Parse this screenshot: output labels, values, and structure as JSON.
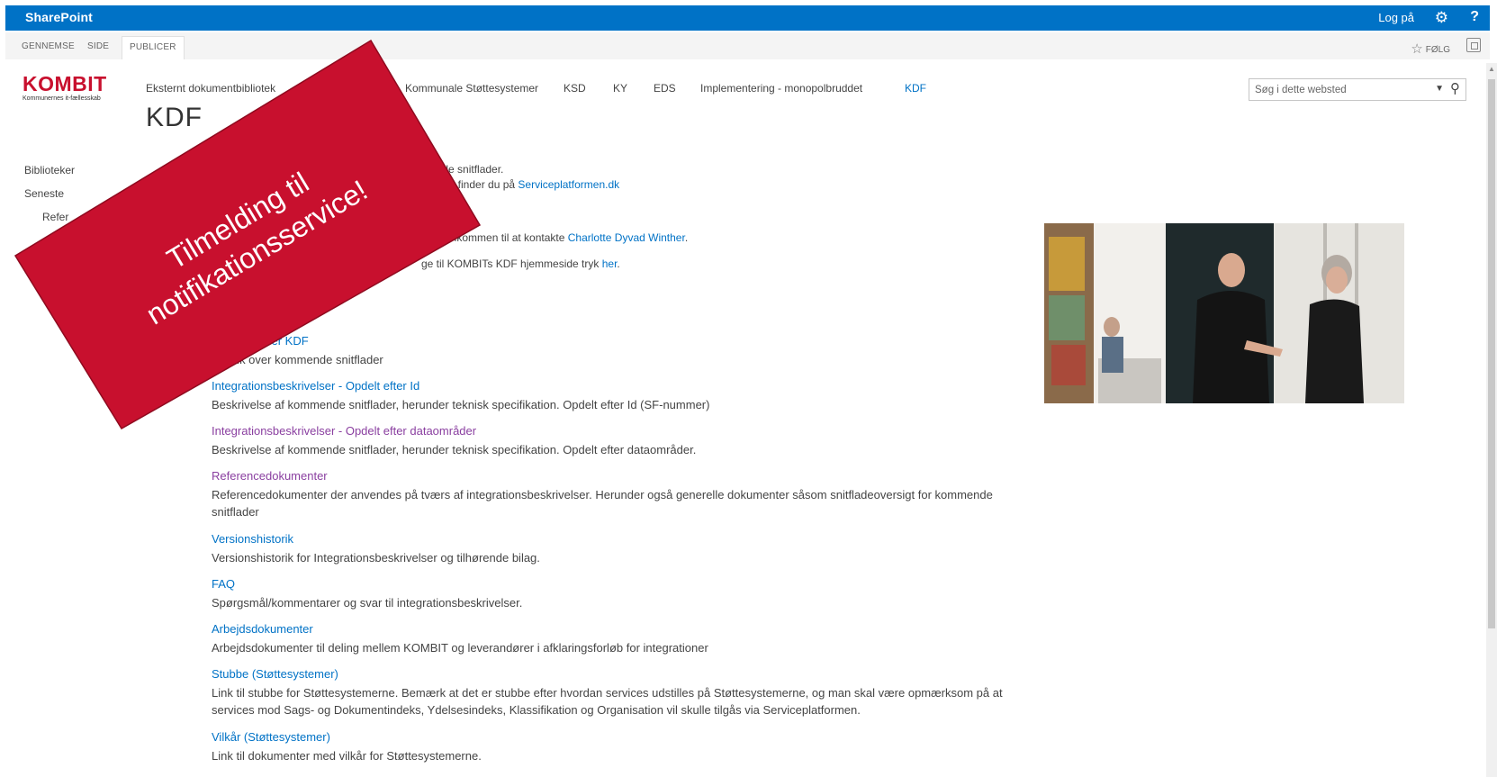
{
  "suitebar": {
    "brand": "SharePoint",
    "signin": "Log på",
    "gear_icon": "gear-icon",
    "help_icon": "?"
  },
  "ribbon": {
    "tabs": [
      "GENNEMSE",
      "SIDE",
      "PUBLICER"
    ],
    "follow_label": "FØLG"
  },
  "logo": {
    "name": "KOMBIT",
    "subtitle": "Kommunernes it-fællesskab"
  },
  "topnav": {
    "items": [
      "Eksternt dokumentbibliotek",
      "Kommunale Støttesystemer",
      "KSD",
      "KY",
      "EDS",
      "Implementering - monopolbruddet",
      "KDF"
    ]
  },
  "search": {
    "placeholder": "Søg i dette websted"
  },
  "page_title": "KDF",
  "leftnav": {
    "items": [
      "Biblioteker",
      "Seneste",
      "Refer"
    ]
  },
  "intro": {
    "line1": "mende snitflader.",
    "line2_prefix": "formen finder du på ",
    "line2_link": "Serviceplatformen.dk",
    "line3_prefix": "r du velkommen til at kontakte ",
    "line3_link": "Charlotte Dyvad Winther",
    "line3_suffix": ".",
    "line4_prefix": "ge til KOMBITs KDF hjemmeside tryk ",
    "line4_link": "her",
    "line4_suffix": "."
  },
  "content": {
    "items": [
      {
        "title": "nde snitflader KDF",
        "desc": "verblik over kommende snitflader"
      },
      {
        "title": "Integrationsbeskrivelser - Opdelt efter Id",
        "desc": "Beskrivelse af kommende snitflader, herunder teknisk specifikation. Opdelt efter Id (SF-nummer)"
      },
      {
        "title": "Integrationsbeskrivelser - Opdelt efter dataområder",
        "desc": "Beskrivelse af kommende snitflader, herunder teknisk specifikation. Opdelt efter dataområder."
      },
      {
        "title": "Referencedokumenter",
        "desc": "Referencedokumenter der anvendes på tværs af integrationsbeskrivelser. Herunder også generelle dokumenter såsom snitfladeoversigt for kommende snitflader"
      },
      {
        "title": "Versionshistorik",
        "desc": "Versionshistorik for Integrationsbeskrivelser og tilhørende bilag."
      },
      {
        "title": "FAQ",
        "desc": "Spørgsmål/kommentarer og svar til integrationsbeskrivelser."
      },
      {
        "title": "Arbejdsdokumenter",
        "desc": "Arbejdsdokumenter til deling mellem KOMBIT og leverandører i afklaringsforløb for integrationer"
      },
      {
        "title": "Stubbe (Støttesystemer)",
        "desc": "Link til stubbe for Støttesystemerne. Bemærk at det er stubbe efter hvordan services udstilles på Støttesystemerne, og man skal være opmærksom på at services mod Sags- og Dokumentindeks, Ydelsesindeks, Klassifikation og Organisation vil skulle tilgås via Serviceplatformen."
      },
      {
        "title": "Vilkår (Støttesystemer)",
        "desc": "Link til dokumenter med vilkår for Støttesystemerne."
      }
    ]
  },
  "banner": {
    "line1": "Tilmelding til",
    "line2": "notifikationsservice!",
    "color": "#c8102e"
  },
  "colors": {
    "accent": "#0072c6",
    "visited": "#8a3fa0",
    "brand_red": "#c8102e"
  }
}
